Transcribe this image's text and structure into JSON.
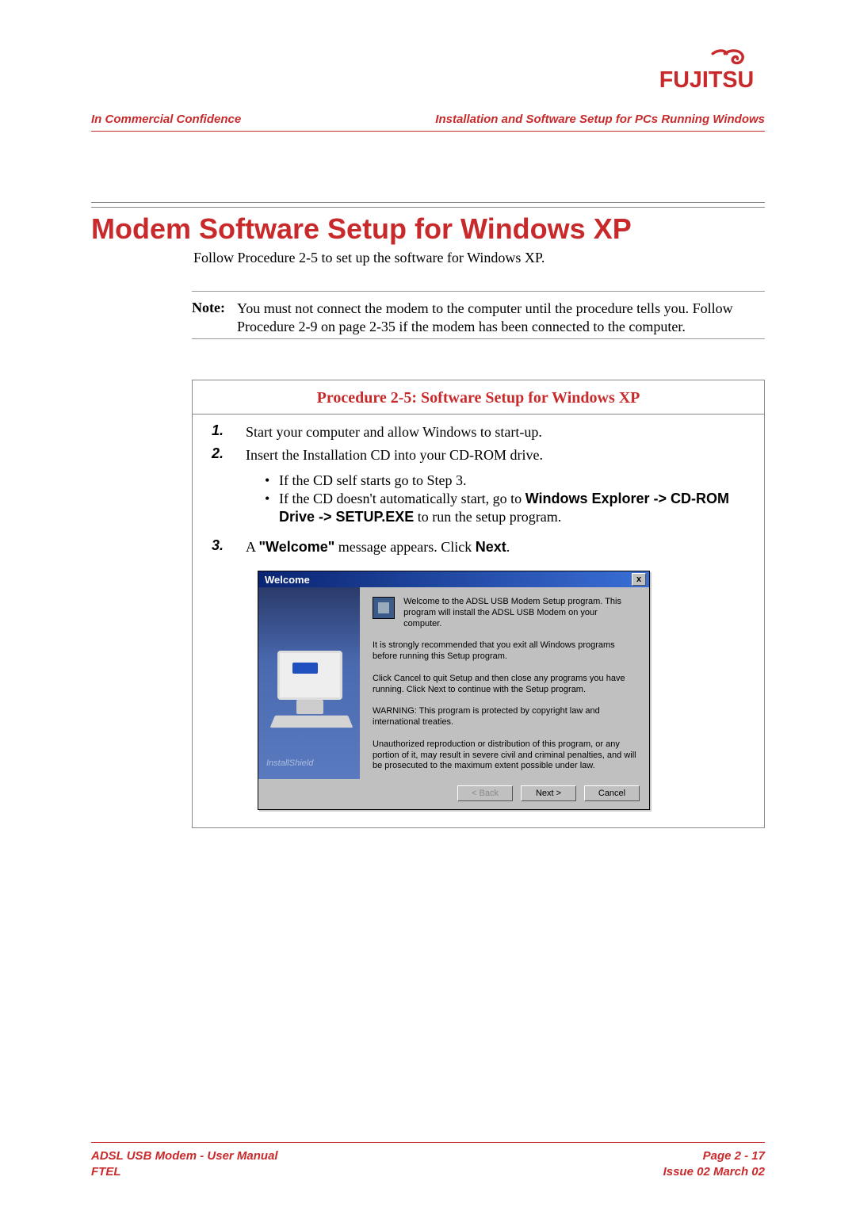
{
  "brand": "FUJITSU",
  "header": {
    "left": "In Commercial Confidence",
    "right": "Installation and Software Setup for PCs Running Windows"
  },
  "section_title": "Modem Software Setup for Windows XP",
  "follow_text": "Follow Procedure 2-5 to set up the software for Windows XP.",
  "note": {
    "label": "Note:",
    "text": "You must not connect the modem to the computer until the procedure tells you. Follow Procedure 2-9 on page 2-35 if the modem has been connected to the computer."
  },
  "procedure": {
    "title": "Procedure 2-5: Software Setup for Windows XP",
    "steps": [
      {
        "num": "1.",
        "text": "Start your computer and allow Windows to start-up."
      },
      {
        "num": "2.",
        "text": "Insert the Installation CD into your CD-ROM drive.",
        "bullets": [
          "If the CD self starts go to Step 3.",
          {
            "prefix": "If the CD doesn't automatically start, go to ",
            "bold": "Windows Explorer -> CD-ROM Drive -> SETUP.EXE",
            "suffix": " to run the setup program."
          }
        ]
      },
      {
        "num": "3.",
        "html_parts": {
          "prefix": "A ",
          "quoted_bold": "\"Welcome\"",
          "mid": " message appears. Click ",
          "bold2": "Next",
          "suffix": "."
        }
      }
    ]
  },
  "dialog": {
    "title": "Welcome",
    "close": "x",
    "welcome": "Welcome to the ADSL USB Modem Setup program. This program will install the ADSL USB Modem on your computer.",
    "p1": "It is strongly recommended that you exit all Windows programs before running this Setup program.",
    "p2": "Click Cancel to quit Setup and then close any programs you have running. Click Next to continue with the Setup program.",
    "p3": "WARNING: This program is protected by copyright law and international treaties.",
    "p4": "Unauthorized reproduction or distribution of this program, or any portion of it, may result in severe civil and criminal penalties, and will be prosecuted to the maximum extent possible under law.",
    "install_tag": "InstallShield",
    "buttons": {
      "back": "< Back",
      "next": "Next >",
      "cancel": "Cancel"
    }
  },
  "footer": {
    "l1": "ADSL USB Modem - User Manual",
    "l2": "FTEL",
    "r1": "Page 2 - 17",
    "r2": "Issue 02 March 02"
  }
}
